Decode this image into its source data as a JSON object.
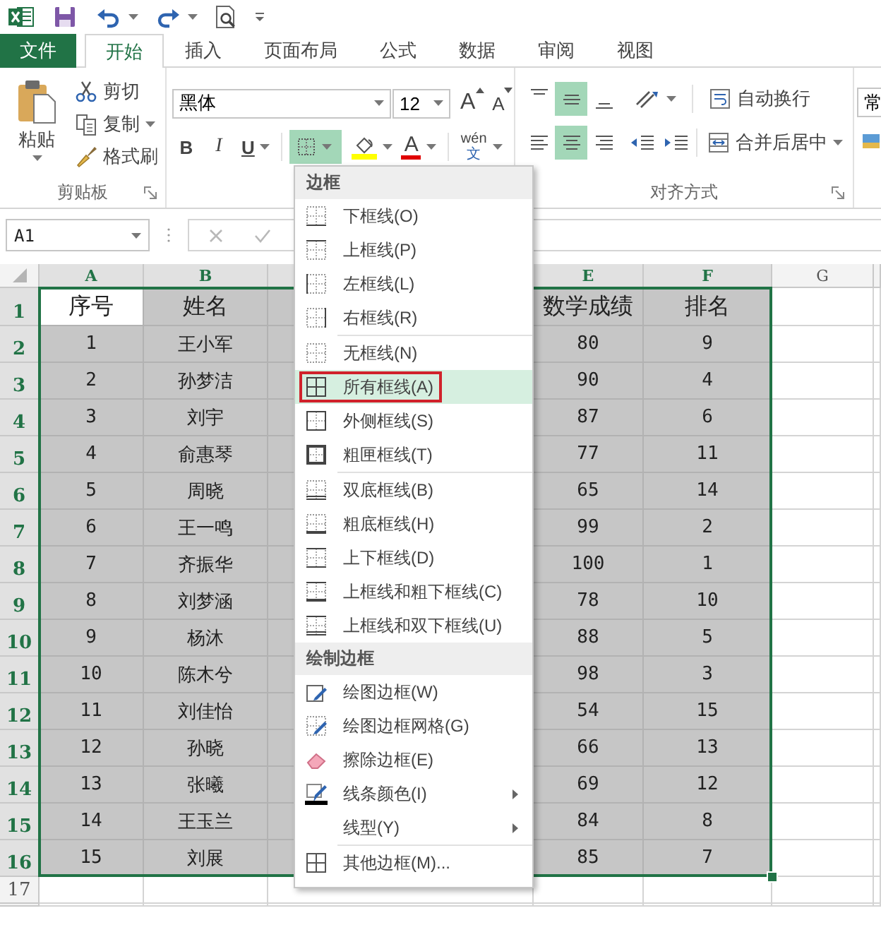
{
  "tabs": [
    {
      "label": "文件",
      "kind": "file",
      "selected": false
    },
    {
      "label": "开始",
      "kind": "tab",
      "selected": true
    },
    {
      "label": "插入",
      "kind": "tab",
      "selected": false
    },
    {
      "label": "页面布局",
      "kind": "tab",
      "selected": false
    },
    {
      "label": "公式",
      "kind": "tab",
      "selected": false
    },
    {
      "label": "数据",
      "kind": "tab",
      "selected": false
    },
    {
      "label": "审阅",
      "kind": "tab",
      "selected": false
    },
    {
      "label": "视图",
      "kind": "tab",
      "selected": false
    }
  ],
  "ribbon": {
    "clipboard": {
      "paste": "粘贴",
      "cut": "剪切",
      "copy": "复制",
      "format_painter": "格式刷",
      "group_label": "剪贴板"
    },
    "font": {
      "font_name": "黑体",
      "font_size": "12",
      "grow": "A",
      "shrink": "A",
      "bold": "B",
      "italic": "I",
      "underline": "U",
      "border_button_expanded": true,
      "font_color": "A",
      "phonetic_top": "wén",
      "phonetic_bottom": "文"
    },
    "alignment": {
      "vertical": [
        {
          "kind": "top",
          "selected": false
        },
        {
          "kind": "middle",
          "selected": true
        },
        {
          "kind": "bottom",
          "selected": false
        }
      ],
      "horizontal": [
        {
          "kind": "left",
          "selected": false
        },
        {
          "kind": "center",
          "selected": true
        },
        {
          "kind": "right",
          "selected": false
        }
      ],
      "wrap_text": "自动换行",
      "merge_center": "合并后居中",
      "group_label": "对齐方式"
    },
    "number": {
      "format": "常"
    }
  },
  "formula_bar": {
    "name_box": "A1"
  },
  "sheet": {
    "columns": [
      {
        "label": "A",
        "kind": "visible",
        "selected": true
      },
      {
        "label": "B",
        "kind": "visible",
        "selected": true
      },
      {
        "kind": "covered",
        "selected": true
      },
      {
        "label": "E",
        "kind": "visible",
        "selected": true
      },
      {
        "label": "F",
        "kind": "visible",
        "selected": true
      },
      {
        "label": "G",
        "kind": "visible",
        "selected": false
      }
    ],
    "rows": [
      {
        "number": "1",
        "kind": "header",
        "selected": true,
        "has_active_cell": true,
        "cells": [
          "序号",
          "姓名",
          "数学成绩",
          "排名"
        ]
      },
      {
        "number": "2",
        "kind": "data",
        "selected": true,
        "has_active_cell": false,
        "cells": [
          "1",
          "王小军",
          "80",
          "9"
        ]
      },
      {
        "number": "3",
        "kind": "data",
        "selected": true,
        "has_active_cell": false,
        "cells": [
          "2",
          "孙梦洁",
          "90",
          "4"
        ]
      },
      {
        "number": "4",
        "kind": "data",
        "selected": true,
        "has_active_cell": false,
        "cells": [
          "3",
          "刘宇",
          "87",
          "6"
        ]
      },
      {
        "number": "5",
        "kind": "data",
        "selected": true,
        "has_active_cell": false,
        "cells": [
          "4",
          "俞惠琴",
          "77",
          "11"
        ]
      },
      {
        "number": "6",
        "kind": "data",
        "selected": true,
        "has_active_cell": false,
        "cells": [
          "5",
          "周晓",
          "65",
          "14"
        ]
      },
      {
        "number": "7",
        "kind": "data",
        "selected": true,
        "has_active_cell": false,
        "cells": [
          "6",
          "王一鸣",
          "99",
          "2"
        ]
      },
      {
        "number": "8",
        "kind": "data",
        "selected": true,
        "has_active_cell": false,
        "cells": [
          "7",
          "齐振华",
          "100",
          "1"
        ]
      },
      {
        "number": "9",
        "kind": "data",
        "selected": true,
        "has_active_cell": false,
        "cells": [
          "8",
          "刘梦涵",
          "78",
          "10"
        ]
      },
      {
        "number": "10",
        "kind": "data",
        "selected": true,
        "has_active_cell": false,
        "cells": [
          "9",
          "杨沐",
          "88",
          "5"
        ]
      },
      {
        "number": "11",
        "kind": "data",
        "selected": true,
        "has_active_cell": false,
        "cells": [
          "10",
          "陈木兮",
          "98",
          "3"
        ]
      },
      {
        "number": "12",
        "kind": "data",
        "selected": true,
        "has_active_cell": false,
        "cells": [
          "11",
          "刘佳怡",
          "54",
          "15"
        ]
      },
      {
        "number": "13",
        "kind": "data",
        "selected": true,
        "has_active_cell": false,
        "cells": [
          "12",
          "孙晓",
          "66",
          "13"
        ]
      },
      {
        "number": "14",
        "kind": "data",
        "selected": true,
        "has_active_cell": false,
        "cells": [
          "13",
          "张曦",
          "69",
          "12"
        ]
      },
      {
        "number": "15",
        "kind": "data",
        "selected": true,
        "has_active_cell": false,
        "cells": [
          "14",
          "王玉兰",
          "84",
          "8"
        ]
      },
      {
        "number": "16",
        "kind": "data",
        "selected": true,
        "has_active_cell": false,
        "cells": [
          "15",
          "刘展",
          "85",
          "7"
        ]
      },
      {
        "number": "17",
        "kind": "data",
        "selected": false
      }
    ]
  },
  "border_menu": {
    "sections": [
      {
        "title": "边框",
        "groups": [
          [
            {
              "label": "下框线(O)",
              "selected": false,
              "outlined": false,
              "submenu": false
            },
            {
              "label": "上框线(P)",
              "selected": false,
              "outlined": false,
              "submenu": false
            },
            {
              "label": "左框线(L)",
              "selected": false,
              "outlined": false,
              "submenu": false
            },
            {
              "label": "右框线(R)",
              "selected": false,
              "outlined": false,
              "submenu": false
            }
          ],
          [
            {
              "label": "无框线(N)",
              "selected": false,
              "outlined": false,
              "submenu": false
            },
            {
              "label": "所有框线(A)",
              "selected": true,
              "outlined": true,
              "submenu": false
            },
            {
              "label": "外侧框线(S)",
              "selected": false,
              "outlined": false,
              "submenu": false
            },
            {
              "label": "粗匣框线(T)",
              "selected": false,
              "outlined": false,
              "submenu": false
            }
          ],
          [
            {
              "label": "双底框线(B)",
              "selected": false,
              "outlined": false,
              "submenu": false
            },
            {
              "label": "粗底框线(H)",
              "selected": false,
              "outlined": false,
              "submenu": false
            },
            {
              "label": "上下框线(D)",
              "selected": false,
              "outlined": false,
              "submenu": false
            },
            {
              "label": "上框线和粗下框线(C)",
              "selected": false,
              "outlined": false,
              "submenu": false
            },
            {
              "label": "上框线和双下框线(U)",
              "selected": false,
              "outlined": false,
              "submenu": false
            }
          ]
        ]
      },
      {
        "title": "绘制边框",
        "groups": [
          [
            {
              "label": "绘图边框(W)",
              "selected": false,
              "outlined": false,
              "submenu": false
            },
            {
              "label": "绘图边框网格(G)",
              "selected": false,
              "outlined": false,
              "submenu": false
            },
            {
              "label": "擦除边框(E)",
              "selected": false,
              "outlined": false,
              "submenu": false
            },
            {
              "label": "线条颜色(I)",
              "selected": false,
              "outlined": false,
              "submenu": true
            },
            {
              "label": "线型(Y)",
              "selected": false,
              "outlined": false,
              "submenu": true
            }
          ],
          [
            {
              "label": "其他边框(M)...",
              "selected": false,
              "outlined": false,
              "submenu": false
            }
          ]
        ]
      }
    ]
  }
}
